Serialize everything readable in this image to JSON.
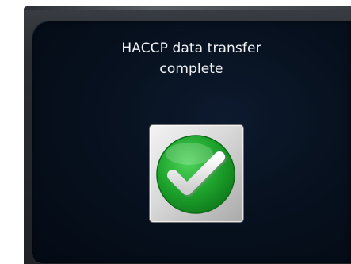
{
  "dialog": {
    "message_line1": "HACCP data transfer",
    "message_line2": "complete",
    "status_icon": "success-checkmark-icon"
  },
  "colors": {
    "dialog_background": "#07111f",
    "text": "#f2f4f7",
    "success_green": "#1fa52d",
    "tile": "#d8d8d8"
  }
}
